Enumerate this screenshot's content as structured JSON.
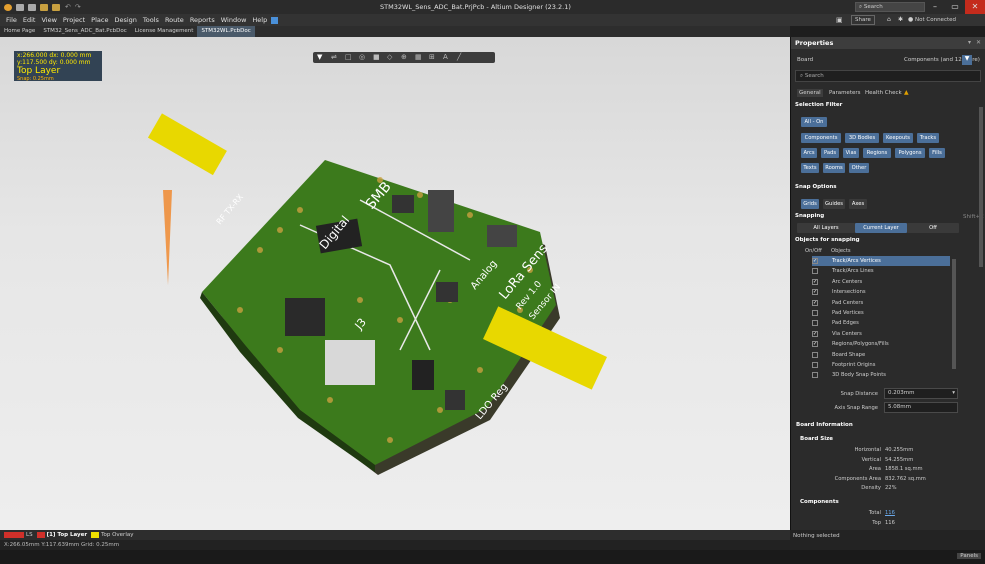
{
  "titlebar": {
    "title": "STM32WL_Sens_ADC_Bat.PrjPcb - Altium Designer (23.2.1)",
    "search": "Search"
  },
  "menubar": [
    "File",
    "Edit",
    "View",
    "Project",
    "Place",
    "Design",
    "Tools",
    "Route",
    "Reports",
    "Window",
    "Help"
  ],
  "topright": {
    "share": "Share",
    "connection": "Not Connected"
  },
  "tabs": [
    "Home Page",
    "STM32_Sens_ADC_Bat.PcbDoc",
    "License Management",
    "STM32WL.PcbDoc"
  ],
  "hud": {
    "x": "x:266.000",
    "dx": "dx: 0.000 mm",
    "y": "y:117.500",
    "dy": "dy: 0.000 mm",
    "layer": "Top Layer",
    "snap": "Snap: 0.25mm"
  },
  "layers": {
    "ls": "LS",
    "top": "[1] Top Layer",
    "overlay": "Top Overlay"
  },
  "status": "X:266.05mm Y:117.639mm Grid: 0.25mm",
  "panel": {
    "title": "Properties",
    "board": "Board",
    "components": "Components (and 12 more)",
    "search": "Search",
    "tabs": [
      "General",
      "Parameters",
      "Health Check"
    ],
    "selection_filter": "Selection Filter",
    "all_on": "All - On",
    "filters": [
      "Components",
      "3D Bodies",
      "Keepouts",
      "Tracks",
      "Arcs",
      "Pads",
      "Vias",
      "Regions",
      "Polygons",
      "Fills",
      "Texts",
      "Rooms",
      "Other"
    ],
    "snap_options": "Snap Options",
    "snap_tabs": [
      "Grids",
      "Guides",
      "Axes"
    ],
    "snapping": "Snapping",
    "shortcut": "Shift+E",
    "snap_modes": [
      "All Layers",
      "Current Layer",
      "Off"
    ],
    "objects_for_snapping": "Objects for snapping",
    "col_onoff": "On/Off",
    "col_objects": "Objects",
    "objects": [
      {
        "name": "Track/Arcs Vertices",
        "on": true
      },
      {
        "name": "Track/Arcs Lines",
        "on": false
      },
      {
        "name": "Arc Centers",
        "on": true
      },
      {
        "name": "Intersections",
        "on": true
      },
      {
        "name": "Pad Centers",
        "on": true
      },
      {
        "name": "Pad Vertices",
        "on": false
      },
      {
        "name": "Pad Edges",
        "on": false
      },
      {
        "name": "Via Centers",
        "on": true
      },
      {
        "name": "Regions/Polygons/Fills",
        "on": true
      },
      {
        "name": "Board Shape",
        "on": false
      },
      {
        "name": "Footprint Origins",
        "on": false
      },
      {
        "name": "3D Body Snap Points",
        "on": false
      }
    ],
    "snap_distance_label": "Snap Distance",
    "snap_distance": "0.203mm",
    "axis_snap_label": "Axis Snap Range",
    "axis_snap": "5.08mm",
    "board_info": "Board Information",
    "board_size": "Board Size",
    "size_rows": [
      {
        "k": "Horizontal",
        "v": "40.255mm"
      },
      {
        "k": "Vertical",
        "v": "54.255mm"
      },
      {
        "k": "Area",
        "v": "1858.1 sq.mm"
      },
      {
        "k": "Components Area",
        "v": "832.762 sq.mm"
      },
      {
        "k": "Density",
        "v": "22%"
      }
    ],
    "components_hdr": "Components",
    "comp_rows": [
      {
        "k": "Total",
        "v": "116"
      },
      {
        "k": "Top",
        "v": "116"
      }
    ],
    "nothing_selected": "Nothing selected",
    "panels_btn": "Panels"
  },
  "pcb_labels": [
    "SMB",
    "Digital",
    "Analog",
    "LoRa Sens",
    "Rev 1.0",
    "Sensor IN",
    "LDO Reg",
    "RF TX-RX",
    "J3"
  ]
}
